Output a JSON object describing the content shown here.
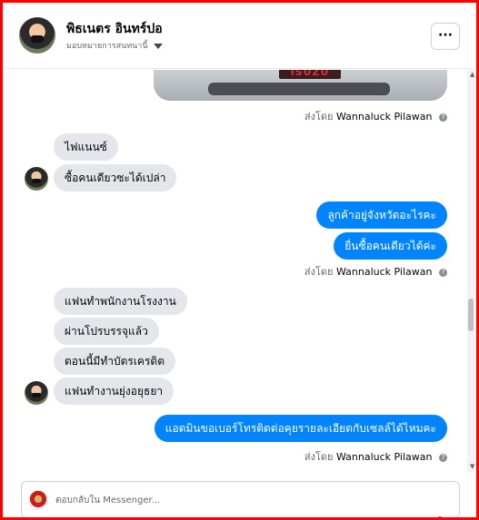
{
  "header": {
    "name": "พิธเนตร อินทร์ปอ",
    "subtitle": "มอบหมายการสนทนานี้",
    "more_label": "···"
  },
  "photo": {
    "plate_text": "ISUZU"
  },
  "messages": [
    {
      "type": "sent_by",
      "prefix": "ส่งโดย",
      "author": "Wannaluck Pilawan"
    },
    {
      "type": "incoming",
      "text": "ไฟแนนซ์"
    },
    {
      "type": "incoming",
      "text": "ซื้อคนเดียวซะได้เปล่า"
    },
    {
      "type": "outgoing",
      "text": "ลูกค้าอยู่จังหวัดอะไรคะ"
    },
    {
      "type": "outgoing",
      "text": "ยื่นซื้อคนเดียวได้ค่ะ"
    },
    {
      "type": "sent_by",
      "prefix": "ส่งโดย",
      "author": "Wannaluck Pilawan"
    },
    {
      "type": "incoming",
      "text": "แฟนทำพนักงานโรงงาน"
    },
    {
      "type": "incoming",
      "text": "ผ่านโปรบรรจุแล้ว"
    },
    {
      "type": "incoming",
      "text": "ตอนนี้มีทำบัตรเครดิต"
    },
    {
      "type": "incoming",
      "text": "แฟนทำงานยุ่งอยุธยา"
    },
    {
      "type": "outgoing",
      "text": "แอดมินขอเบอร์โทรติดต่อคุยรายละเอียดกับเซลล์ได้ไหมคะ"
    },
    {
      "type": "sent_by",
      "prefix": "ส่งโดย",
      "author": "Wannaluck Pilawan"
    }
  ],
  "composer": {
    "placeholder": "ตอบกลับใน Messenger..."
  },
  "colors": {
    "outgoing_bubble": "#0084ff",
    "incoming_bubble": "#e4e6eb",
    "frame_border": "#ff0000"
  },
  "icons": [
    "more-options-icon",
    "caret-down-icon",
    "info-icon",
    "scroll-up-arrow-icon",
    "scroll-down-arrow-icon"
  ]
}
